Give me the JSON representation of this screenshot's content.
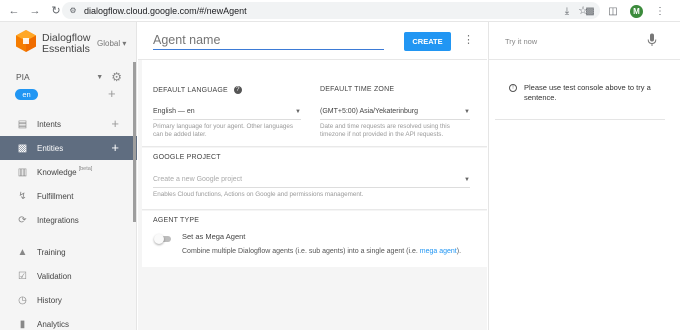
{
  "browser": {
    "url": "dialogflow.cloud.google.com/#/newAgent",
    "profile_initial": "M"
  },
  "sidebar": {
    "brand_line1": "Dialogflow",
    "brand_line2": "Essentials",
    "region": "Global",
    "agent": "PIA",
    "language_pill": "en",
    "items": [
      {
        "label": "Intents",
        "icon": "chat-bubble-icon"
      },
      {
        "label": "Entities",
        "icon": "sitemap-icon",
        "active": true
      },
      {
        "label": "Knowledge",
        "badge": "[beta]",
        "icon": "book-icon"
      },
      {
        "label": "Fulfillment",
        "icon": "lightning-icon"
      },
      {
        "label": "Integrations",
        "icon": "integrations-icon"
      },
      {
        "label": "Training",
        "icon": "graduation-cap-icon"
      },
      {
        "label": "Validation",
        "icon": "check-square-icon"
      },
      {
        "label": "History",
        "icon": "clock-icon"
      },
      {
        "label": "Analytics",
        "icon": "chart-icon"
      }
    ]
  },
  "header": {
    "agent_name_placeholder": "Agent name",
    "create_label": "CREATE"
  },
  "form": {
    "default_language": {
      "label": "DEFAULT LANGUAGE",
      "value": "English — en",
      "hint": "Primary language for your agent. Other languages can be added later."
    },
    "default_time_zone": {
      "label": "DEFAULT TIME ZONE",
      "value": "(GMT+5:00) Asia/Yekaterinburg",
      "hint": "Date and time requests are resolved using this timezone if not provided in the API requests."
    },
    "google_project": {
      "label": "GOOGLE PROJECT",
      "placeholder": "Create a new Google project",
      "hint": "Enables Cloud functions, Actions on Google and permissions management."
    },
    "agent_type": {
      "label": "AGENT TYPE",
      "toggle_label": "Set as Mega Agent",
      "toggle_on": false,
      "description_prefix": "Combine multiple Dialogflow agents (i.e. sub agents) into a single agent (i.e. ",
      "description_link": "mega agent",
      "description_suffix": ")."
    }
  },
  "test_console": {
    "placeholder": "Try it now",
    "info_message": "Please use test console above to try a sentence."
  },
  "colors": {
    "accent": "#2196f3",
    "sidebar_active": "#5f6d80",
    "sidebar_bg": "#f5f5f5"
  }
}
